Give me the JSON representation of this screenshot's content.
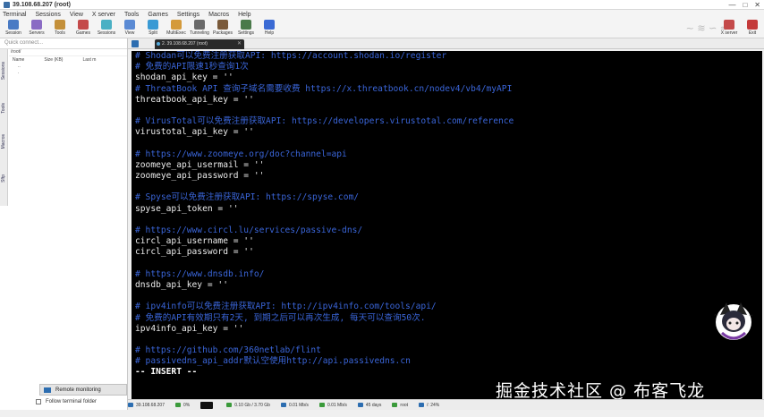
{
  "window": {
    "title": "39.108.68.207 (root)",
    "controls": [
      "—",
      "□",
      "✕"
    ]
  },
  "menu": [
    "Terminal",
    "Sessions",
    "View",
    "X server",
    "Tools",
    "Games",
    "Settings",
    "Macros",
    "Help"
  ],
  "toolbar": {
    "left": [
      {
        "label": "Session",
        "icon": "session-icon",
        "color": "#4a7bc4"
      },
      {
        "label": "Servers",
        "icon": "servers-icon",
        "color": "#8a6bc4"
      },
      {
        "label": "Tools",
        "icon": "tools-icon",
        "color": "#c4903a"
      },
      {
        "label": "Games",
        "icon": "games-icon",
        "color": "#c44a4a"
      },
      {
        "label": "Sessions",
        "icon": "sessions-icon",
        "color": "#4ab0c4"
      },
      {
        "label": "View",
        "icon": "view-icon",
        "color": "#5a8ad4"
      },
      {
        "label": "Split",
        "icon": "split-icon",
        "color": "#3a9ad4"
      },
      {
        "label": "MultiExec",
        "icon": "multiexec-icon",
        "color": "#d49a3a"
      },
      {
        "label": "Tunneling",
        "icon": "tunneling-icon",
        "color": "#6a6a6a"
      },
      {
        "label": "Packages",
        "icon": "packages-icon",
        "color": "#7a5a3a"
      },
      {
        "label": "Settings",
        "icon": "settings-icon",
        "color": "#4a7a4a"
      },
      {
        "label": "Help",
        "icon": "help-icon",
        "color": "#3a6ad4"
      }
    ],
    "right": [
      {
        "label": "X server",
        "icon": "xserver-icon",
        "color": "#c44a4a"
      },
      {
        "label": "Exit",
        "icon": "exit-icon",
        "color": "#c43a3a"
      }
    ]
  },
  "sidebar": {
    "quick_connect": "Quick connect...",
    "vtabs": [
      "Sessions",
      "Tools",
      "Macros",
      "Sftp"
    ],
    "path": "/root/",
    "columns": [
      "Name",
      "Size (KB)",
      "Last m"
    ],
    "rows": [
      "..",
      "."
    ],
    "remote_monitoring": "Remote monitoring",
    "follow_folder": "Follow terminal folder"
  },
  "tab": {
    "label": "2. 39.108.68.207 (root)",
    "close": "✕"
  },
  "terminal": {
    "lines": [
      {
        "t": "c",
        "s": "# Shodan可以免费注册获取API: https://account.shodan.io/register"
      },
      {
        "t": "c",
        "s": "# 免费的API限速1秒查询1次"
      },
      {
        "t": "k",
        "s": "shodan_api_key = ''"
      },
      {
        "t": "c",
        "s": "# ThreatBook API 查询子域名需要收费 https://x.threatbook.cn/nodev4/vb4/myAPI"
      },
      {
        "t": "k",
        "s": "threatbook_api_key = ''"
      },
      {
        "t": "b",
        "s": ""
      },
      {
        "t": "c",
        "s": "# VirusTotal可以免费注册获取API: https://developers.virustotal.com/reference"
      },
      {
        "t": "k",
        "s": "virustotal_api_key = ''"
      },
      {
        "t": "b",
        "s": ""
      },
      {
        "t": "c",
        "s": "# https://www.zoomeye.org/doc?channel=api"
      },
      {
        "t": "k",
        "s": "zoomeye_api_usermail = ''"
      },
      {
        "t": "k",
        "s": "zoomeye_api_password = ''"
      },
      {
        "t": "b",
        "s": ""
      },
      {
        "t": "c",
        "s": "# Spyse可以免费注册获取API: https://spyse.com/"
      },
      {
        "t": "k",
        "s": "spyse_api_token = ''"
      },
      {
        "t": "b",
        "s": ""
      },
      {
        "t": "c",
        "s": "# https://www.circl.lu/services/passive-dns/"
      },
      {
        "t": "k",
        "s": "circl_api_username = ''"
      },
      {
        "t": "k",
        "s": "circl_api_password = ''"
      },
      {
        "t": "b",
        "s": ""
      },
      {
        "t": "c",
        "s": "# https://www.dnsdb.info/"
      },
      {
        "t": "k",
        "s": "dnsdb_api_key = ''"
      },
      {
        "t": "b",
        "s": ""
      },
      {
        "t": "c",
        "s": "# ipv4info可以免费注册获取API: http://ipv4info.com/tools/api/"
      },
      {
        "t": "c",
        "s": "# 免费的API有效期只有2天, 到期之后可以再次生成, 每天可以查询50次."
      },
      {
        "t": "k",
        "s": "ipv4info_api_key = ''"
      },
      {
        "t": "b",
        "s": ""
      },
      {
        "t": "c",
        "s": "# https://github.com/360netlab/flint"
      },
      {
        "t": "c",
        "s": "# passivedns_api_addr默认空使用http://api.passivedns.cn"
      },
      {
        "t": "i",
        "s": "-- INSERT --"
      }
    ]
  },
  "watermark": "掘金技术社区 @ 布客飞龙",
  "status": [
    {
      "label": "39.108.68.207",
      "icon": "server-icon"
    },
    {
      "label": "0%",
      "icon": "cpu-icon"
    },
    {
      "label": "",
      "icon": "terminal-status-icon"
    },
    {
      "label": "0.10 Gb / 3.70 Gb",
      "icon": "memory-icon"
    },
    {
      "label": "0.01 Mb/s",
      "icon": "upload-icon"
    },
    {
      "label": "0.01 Mb/s",
      "icon": "download-icon"
    },
    {
      "label": "45 days",
      "icon": "uptime-icon"
    },
    {
      "label": "root",
      "icon": "user-icon"
    },
    {
      "label": "/: 24%",
      "icon": "disk-icon"
    }
  ]
}
